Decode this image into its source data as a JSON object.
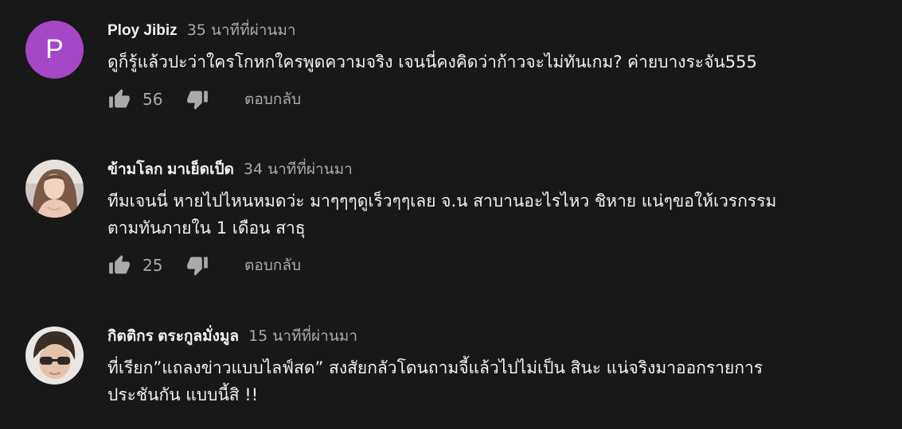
{
  "comments": [
    {
      "avatar_letter": "P",
      "author": "Ploy Jibiz",
      "time": "35 นาทีที่ผ่านมา",
      "lines": [
        "ดูก็รู้แล้วปะว่าใครโกหกใครพูดความจริง เจนนี่คงคิดว่าก้าวจะไม่ทันเกม?  ค่ายบางระจัน555"
      ],
      "likes": "56",
      "reply_label": "ตอบกลับ"
    },
    {
      "author": "ข้ามโลก มาเย็ดเป็ด",
      "time": "34 นาทีที่ผ่านมา",
      "lines": [
        "ทีมเจนนี่ หายไปไหนหมดว่ะ มาๆๆๆดูเร็วๆๆเลย จ.น สาบานอะไรไหว ชิหาย แน่ๆขอให้เวรกรรม",
        "ตามทันภายใน 1 เดือน สาธุ"
      ],
      "likes": "25",
      "reply_label": "ตอบกลับ"
    },
    {
      "author": "กิตติกร ตระกูลมั่งมูล",
      "time": "15 นาทีที่ผ่านมา",
      "lines": [
        "ที่เรียก”แถลงข่าวแบบไลฟ์สด” สงสัยกลัวโดนถามจี้แล้วไปไม่เป็น สินะ แน่จริงมาออกรายการ",
        "ประชันกัน แบบนี้สิ !!"
      ]
    }
  ],
  "colors": {
    "background": "#181818",
    "primary_text": "#f1f1f1",
    "secondary_text": "#aaaaaa",
    "avatar_p": "#a547c6"
  },
  "icons": [
    "thumb-up-icon",
    "thumb-down-icon"
  ]
}
